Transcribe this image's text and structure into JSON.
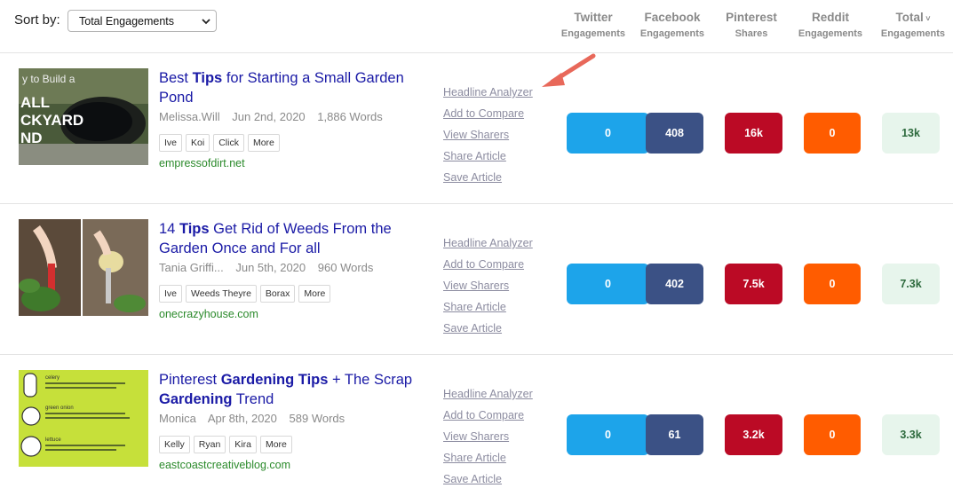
{
  "sort": {
    "label": "Sort by:",
    "value": "Total Engagements"
  },
  "columns": [
    {
      "line1": "Twitter",
      "line2": "Engagements"
    },
    {
      "line1": "Facebook",
      "line2": "Engagements"
    },
    {
      "line1": "Pinterest",
      "line2": "Shares"
    },
    {
      "line1": "Reddit",
      "line2": "Engagements"
    },
    {
      "line1": "Total",
      "line2": "Engagements"
    }
  ],
  "actions": [
    "Headline Analyzer",
    "Add to Compare",
    "View Sharers",
    "Share Article",
    "Save Article"
  ],
  "articles": [
    {
      "title_parts": [
        "Best ",
        "Tips",
        " for Starting a Small Garden Pond"
      ],
      "author": "Melissa.Will",
      "date": "Jun 2nd, 2020",
      "words": "1,886 Words",
      "tags": [
        "Ive",
        "Koi",
        "Click",
        "More"
      ],
      "domain": "empressofdirt.net",
      "thumb_text": [
        "y to Build a",
        "ALL",
        "CKYARD",
        "ND"
      ],
      "twitter": "0",
      "facebook": "408",
      "pinterest": "16k",
      "reddit": "0",
      "total": "13k"
    },
    {
      "title_parts": [
        "14 ",
        "Tips",
        " Get Rid of Weeds From the Garden Once and For all"
      ],
      "author": "Tania Griffi...",
      "date": "Jun 5th, 2020",
      "words": "960 Words",
      "tags": [
        "Ive",
        "Weeds Theyre",
        "Borax",
        "More"
      ],
      "domain": "onecrazyhouse.com",
      "thumb_text": [],
      "twitter": "0",
      "facebook": "402",
      "pinterest": "7.5k",
      "reddit": "0",
      "total": "7.3k"
    },
    {
      "title_parts": [
        "Pinterest ",
        "Gardening Tips",
        " + The Scrap ",
        "Gardening",
        " Trend"
      ],
      "author": "Monica",
      "date": "Apr 8th, 2020",
      "words": "589 Words",
      "tags": [
        "Kelly",
        "Ryan",
        "Kira",
        "More"
      ],
      "domain": "eastcoastcreativeblog.com",
      "thumb_text": [
        "celery",
        "green onion",
        "lettuce"
      ],
      "twitter": "0",
      "facebook": "61",
      "pinterest": "3.2k",
      "reddit": "0",
      "total": "3.3k"
    }
  ],
  "colors": {
    "twitter": "#1da4ea",
    "facebook": "#3b5185",
    "pinterest": "#bb0a25",
    "reddit": "#ff5c00",
    "total_bg": "#e7f5ec",
    "link": "#1a1aa6",
    "domain": "#2b8a2b",
    "arrow": "#e8685a"
  },
  "icons": {
    "select": "chevron-down-icon",
    "total_sort": "chevron-down-icon",
    "annotation": "arrow-annotation-icon"
  }
}
